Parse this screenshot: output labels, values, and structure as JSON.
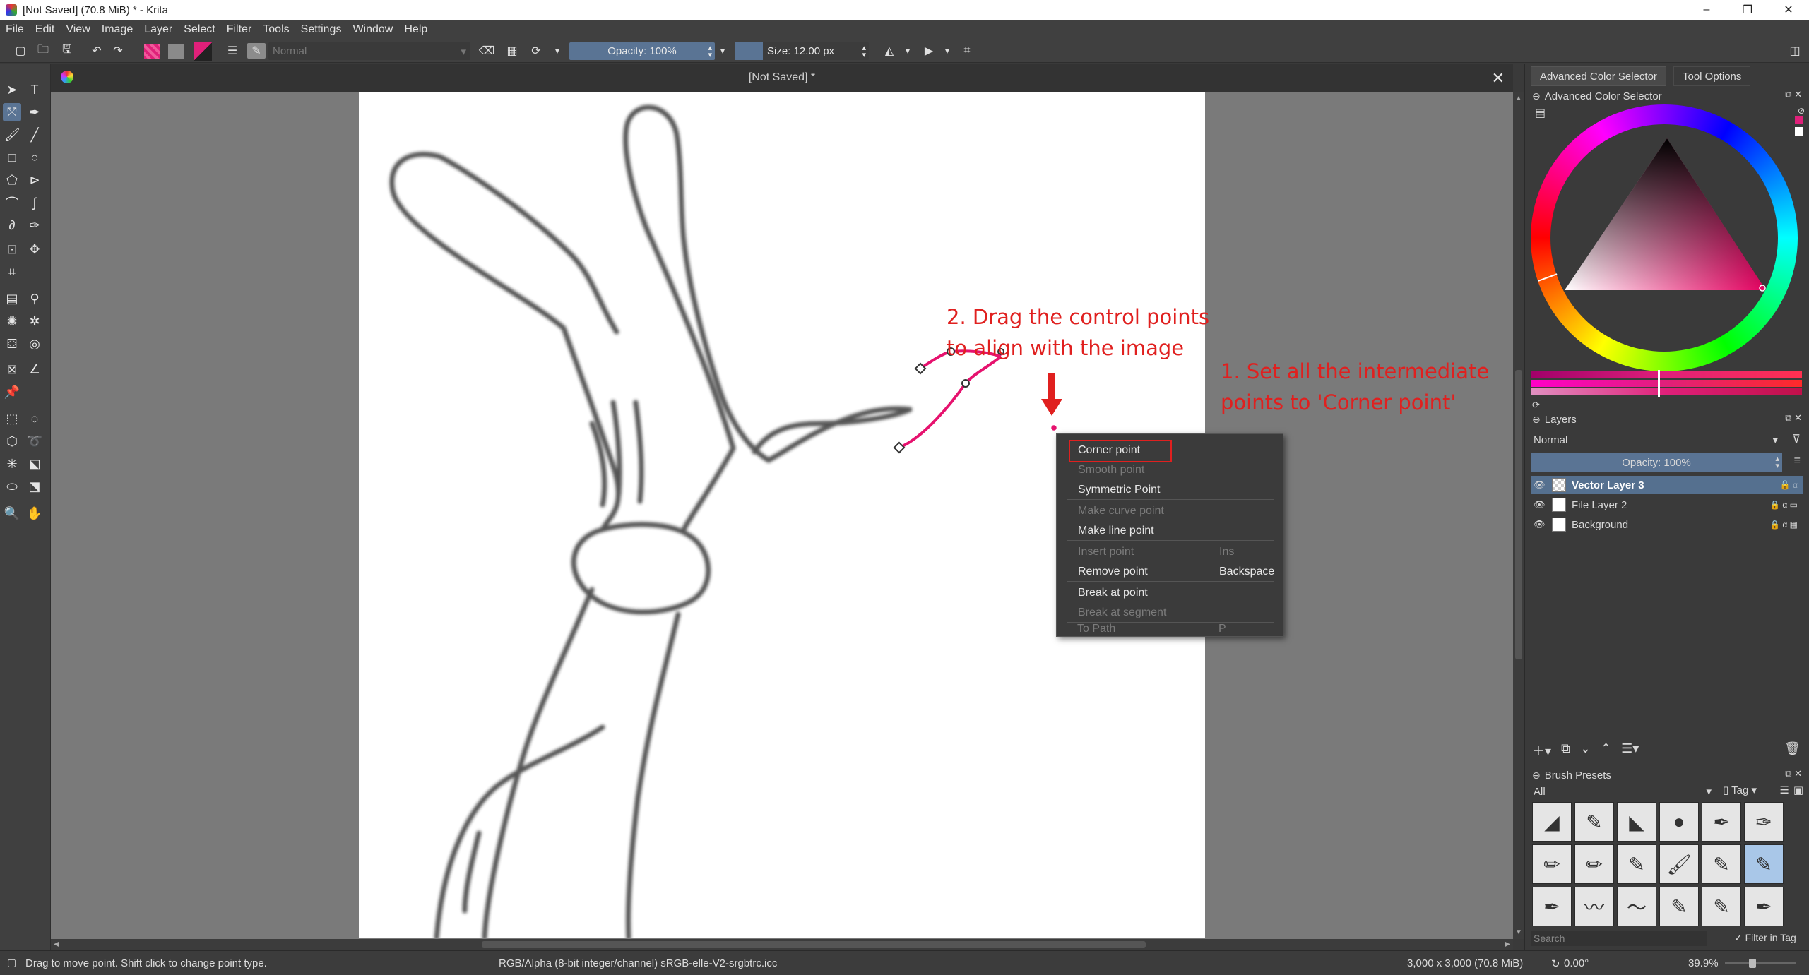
{
  "window": {
    "title": "[Not Saved]  (70.8 MiB)  * - Krita",
    "controls": [
      "–",
      "❐",
      "✕"
    ]
  },
  "menubar": [
    "File",
    "Edit",
    "View",
    "Image",
    "Layer",
    "Select",
    "Filter",
    "Tools",
    "Settings",
    "Window",
    "Help"
  ],
  "toolbar": {
    "blend_mode": "Normal",
    "opacity": "Opacity: 100%",
    "size": "Size: 12.00 px",
    "colors": {
      "foreground": "#e0207a",
      "background": "#7a7a7a",
      "accent_field": "#5a7494"
    }
  },
  "document": {
    "tab_title": "[Not Saved]  *",
    "close": "✕"
  },
  "annotations": {
    "step2_line1": "2. Drag the control points",
    "step2_line2": "to align with the image",
    "step1_line1": "1. Set all the intermediate",
    "step1_line2": "points to 'Corner point'"
  },
  "context_menu": {
    "items": [
      {
        "label": "Corner point",
        "shortcut": "",
        "enabled": true,
        "highlighted": true
      },
      {
        "label": "Smooth point",
        "shortcut": "",
        "enabled": false
      },
      {
        "label": "Symmetric Point",
        "shortcut": "",
        "enabled": true
      },
      {
        "label": "Make curve point",
        "shortcut": "",
        "enabled": false
      },
      {
        "label": "Make line point",
        "shortcut": "",
        "enabled": true
      },
      {
        "label": "Insert point",
        "shortcut": "Ins",
        "enabled": false
      },
      {
        "label": "Remove point",
        "shortcut": "Backspace",
        "enabled": true
      },
      {
        "label": "Break at point",
        "shortcut": "",
        "enabled": true
      },
      {
        "label": "Break at segment",
        "shortcut": "",
        "enabled": false
      },
      {
        "label": "To Path",
        "shortcut": "P",
        "enabled": false
      }
    ]
  },
  "dock": {
    "tabs": [
      "Advanced Color Selector",
      "Tool Options"
    ],
    "color_selector_title": "Advanced Color Selector",
    "layers": {
      "title": "Layers",
      "blend_mode": "Normal",
      "opacity": "Opacity:  100%",
      "rows": [
        {
          "name": "Vector Layer 3",
          "selected": true
        },
        {
          "name": "File Layer 2",
          "selected": false
        },
        {
          "name": "Background",
          "selected": false
        }
      ]
    },
    "brush_presets": {
      "title": "Brush Presets",
      "filter": "All",
      "tag": "Tag",
      "search_placeholder": "Search",
      "filter_in_tag": "Filter in Tag"
    }
  },
  "status": {
    "hint": "Drag to move point. Shift click to change point type.",
    "color_space": "RGB/Alpha (8-bit integer/channel)  sRGB-elle-V2-srgbtrc.icc",
    "image_size": "3,000 x 3,000 (70.8 MiB)",
    "rotation": "0.00°",
    "zoom": "39.9%"
  }
}
